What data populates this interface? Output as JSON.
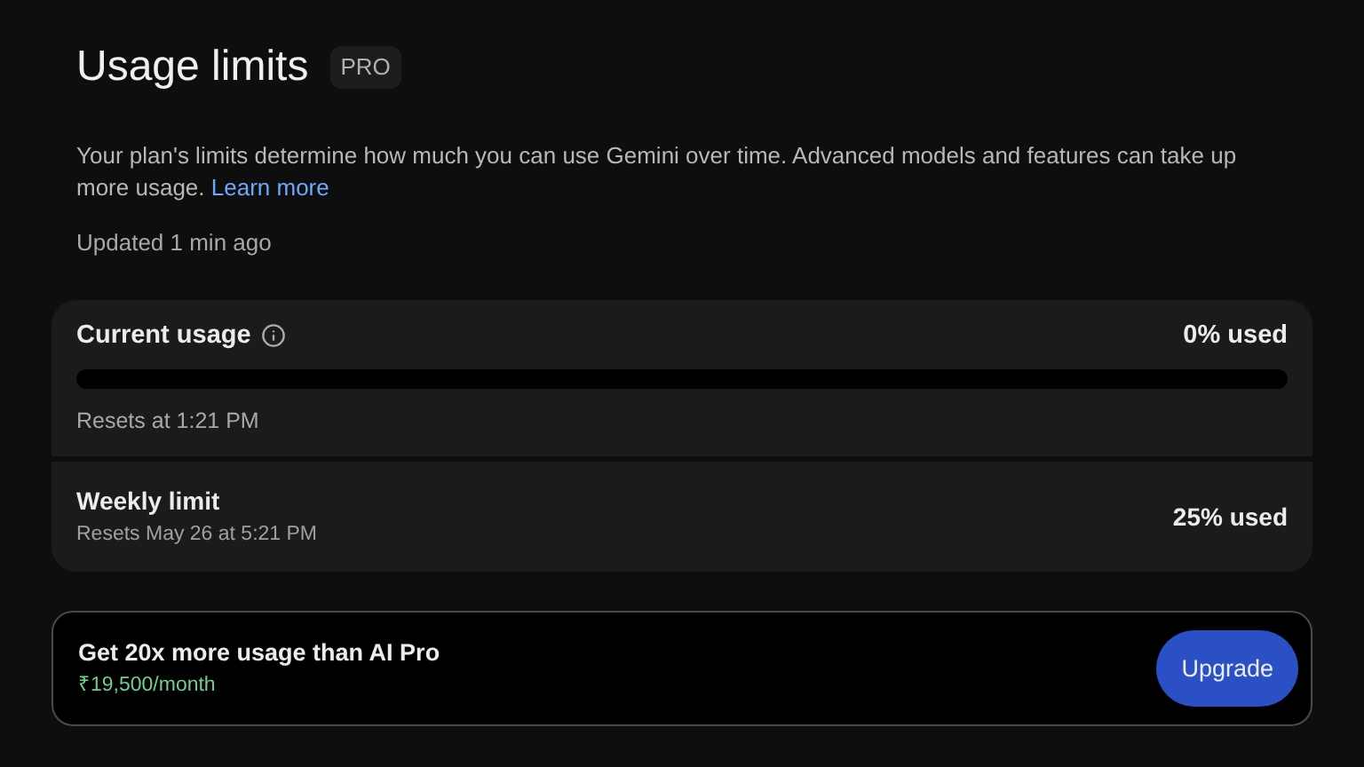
{
  "title": "Usage limits",
  "badge": "PRO",
  "description": "Your plan's limits determine how much you can use Gemini over time. Advanced models and features can take up more usage.",
  "learn_more": "Learn more",
  "updated": "Updated 1 min ago",
  "limits": [
    {
      "kind": "bar",
      "name": "Current usage",
      "reading": "0% used",
      "level": 0,
      "resets": "Resets at 1:21 PM"
    },
    {
      "kind": "plain",
      "name": "Weekly limit",
      "reading": "25% used",
      "resets": "Resets May 26 at 5:21 PM"
    }
  ],
  "upgrade": {
    "headline": "Get 20x more usage than AI Pro",
    "price": "₹19,500/month",
    "button": "Upgrade"
  }
}
